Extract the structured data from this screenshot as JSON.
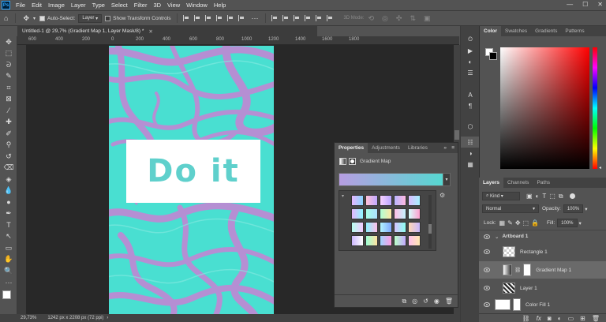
{
  "menu": [
    "File",
    "Edit",
    "Image",
    "Layer",
    "Type",
    "Select",
    "Filter",
    "3D",
    "View",
    "Window",
    "Help"
  ],
  "app_logo": "Ps",
  "options": {
    "auto_select_label": "Auto-Select:",
    "auto_select_value": "Layer",
    "transform_label": "Show Transform Controls",
    "mode_3d_label": "3D Mode:"
  },
  "doc": {
    "tab_title": "Untitled-1 @ 29,7% (Gradient Map 1, Layer Mask/8) *",
    "zoom": "29,73%",
    "size": "1242 px x 2208 px (72 ppi)"
  },
  "ruler": [
    "600",
    "400",
    "200",
    "0",
    "200",
    "400",
    "600",
    "800",
    "1000",
    "1200",
    "1400",
    "1600",
    "1800"
  ],
  "canvas": {
    "headline": "Do it"
  },
  "color_panel": {
    "tabs": [
      "Color",
      "Swatches",
      "Gradients",
      "Patterns"
    ]
  },
  "properties_panel": {
    "tabs": [
      "Properties",
      "Adjustments",
      "Libraries"
    ],
    "type_label": "Gradient Map"
  },
  "layers_panel": {
    "tabs": [
      "Layers",
      "Channels",
      "Paths"
    ],
    "kind_label": "Kind",
    "blend_mode": "Normal",
    "opacity_label": "Opacity:",
    "opacity_value": "100%",
    "lock_label": "Lock:",
    "fill_label": "Fill:",
    "fill_value": "100%",
    "layers": [
      {
        "name": "Artboard 1"
      },
      {
        "name": "Rectangle 1"
      },
      {
        "name": "Gradient Map 1"
      },
      {
        "name": "Layer 1"
      },
      {
        "name": "Color Fill 1"
      }
    ]
  },
  "colors": {
    "accent": "#49dfd1",
    "marble_purple": "#b58fd3"
  }
}
